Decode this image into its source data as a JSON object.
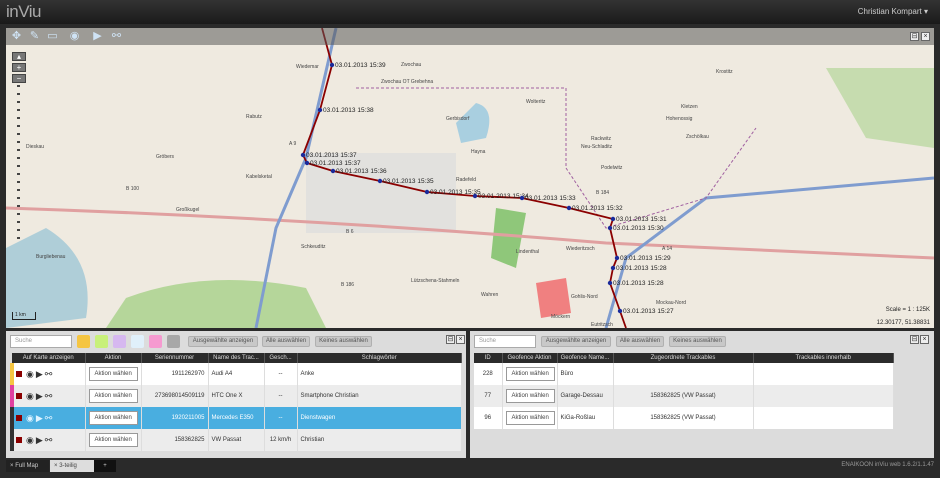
{
  "app": {
    "logo": "inViu",
    "user": "Christian Kompart",
    "user_menu_icon": "caret-down-icon",
    "version": "ENAIKOON inViu web 1.6.2/1.1.47"
  },
  "map": {
    "tools": [
      "pan-icon",
      "pencil-icon",
      "polygon-icon",
      "eye-icon",
      "play-icon",
      "link-icon"
    ],
    "scale": "Scale = 1 : 125K",
    "coords": "12.30177, 51.38831",
    "scalebar": "1 km",
    "towns": [
      "Wiedemar",
      "Zwochau",
      "Zwochau OT Grebehna",
      "Gerbisdorf",
      "Wolteritz",
      "Hayna",
      "Radefeld",
      "Rackwitz",
      "Neu-Schladitz",
      "Podelwitz",
      "Kletzen",
      "Hohenossig",
      "Zschölkau",
      "Krostitz",
      "Schkeuditz",
      "Lindenthal",
      "Wiederitzsch",
      "Lützschena-Stahmeln",
      "Wahren",
      "Gohlis-Nord",
      "Möckern",
      "Eutritzsch",
      "Mockau-Nord",
      "Großkugel",
      "Dieskau",
      "Kabelsketal",
      "Rabutz",
      "Gröbers",
      "Burgliebenau"
    ],
    "roads": [
      "B 6",
      "B 184",
      "B 186",
      "A 14",
      "A 9",
      "B 100"
    ],
    "track_labels": [
      "03.01.2013 15:39",
      "03.01.2013 15:38",
      "03.01.2013 15:37",
      "03.01.2013 15:37",
      "03.01.2013 15:36",
      "03.01.2013 15:35",
      "03.01.2013 15:35",
      "03.01.2013 15:34",
      "03.01.2013 15:33",
      "03.01.2013 15:32",
      "03.01.2013 15:31",
      "03.01.2013 15:30",
      "03.01.2013 15:29",
      "03.01.2013 15:28",
      "03.01.2013 15:28",
      "03.01.2013 15:27"
    ],
    "route_color": "#8b0000"
  },
  "trackables": {
    "search_placeholder": "Suche",
    "colors": [
      "#f5c542",
      "#c8f07a",
      "#d6b8f0",
      "#e0f0fa",
      "#f59ad0",
      "#a8a8a8"
    ],
    "buttons": {
      "show_selected": "Ausgewählte anzeigen",
      "select_all": "Alle auswählen",
      "select_none": "Keines auswählen"
    },
    "columns": [
      "Auf Karte anzeigen",
      "Aktion",
      "Seriennummer",
      "Name des Trac...",
      "Gesch...",
      "Schlagwörter"
    ],
    "rows": [
      {
        "color": "#f5c542",
        "action": "Aktion wählen",
        "serial": "1911262970",
        "name": "Audi A4",
        "speed": "--",
        "tags": "Anke"
      },
      {
        "color": "#e040a0",
        "action": "Aktion wählen",
        "serial": "273698014509119",
        "name": "HTC One X",
        "speed": "--",
        "tags": "Smartphone Christian"
      },
      {
        "color": "#333333",
        "action": "Aktion wählen",
        "serial": "1920211005",
        "name": "Mercedes E350",
        "speed": "--",
        "tags": "Dienstwagen",
        "selected": true
      },
      {
        "color": "#333333",
        "action": "Aktion wählen",
        "serial": "158362825",
        "name": "VW Passat",
        "speed": "12 km/h",
        "tags": "Christian"
      }
    ]
  },
  "geofences": {
    "search_placeholder": "Suche",
    "buttons": {
      "show_selected": "Ausgewählte anzeigen",
      "select_all": "Alle auswählen",
      "select_none": "Keines auswählen"
    },
    "columns": [
      "ID",
      "Geofence Aktion",
      "Geofence Name...",
      "Zugeordnete Trackables",
      "Trackables innerhalb"
    ],
    "rows": [
      {
        "id": "228",
        "action": "Aktion wählen",
        "name": "Büro",
        "assigned": "",
        "inside": ""
      },
      {
        "id": "77",
        "action": "Aktion wählen",
        "name": "Garage-Dessau",
        "assigned": "158362825 (VW Passat)",
        "inside": ""
      },
      {
        "id": "96",
        "action": "Aktion wählen",
        "name": "KiGa-Roßlau",
        "assigned": "158362825 (VW Passat)",
        "inside": ""
      }
    ]
  },
  "tabs": [
    {
      "label": "Full Map",
      "close": "×"
    },
    {
      "label": "3-teilig",
      "close": "×"
    },
    {
      "label": "+"
    }
  ]
}
